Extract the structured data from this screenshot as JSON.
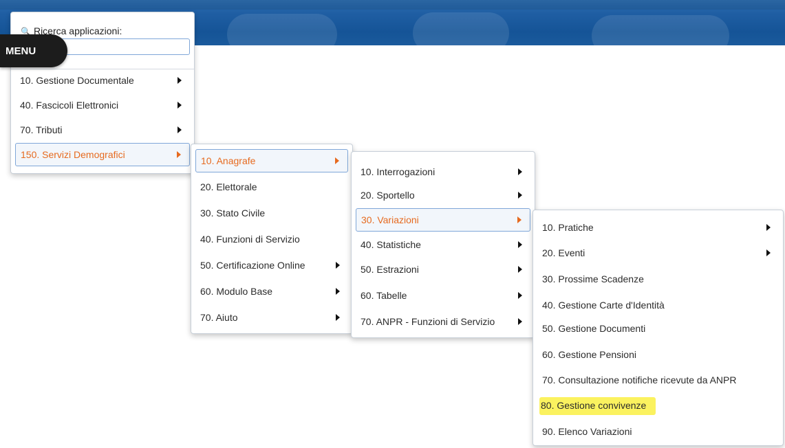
{
  "menu_button": {
    "label": "MENU"
  },
  "search": {
    "label": "Ricerca applicazioni:",
    "value": "",
    "placeholder": ""
  },
  "level1": [
    {
      "label": "10. Gestione Documentale",
      "submenu": true
    },
    {
      "label": "40. Fascicoli Elettronici",
      "submenu": true
    },
    {
      "label": "70. Tributi",
      "submenu": true
    },
    {
      "label": "150. Servizi Demografici",
      "submenu": true,
      "active": true
    }
  ],
  "level2": [
    {
      "label": "10. Anagrafe",
      "submenu": true,
      "active": true
    },
    {
      "label": "20. Elettorale"
    },
    {
      "label": "30. Stato Civile"
    },
    {
      "label": "40. Funzioni di Servizio"
    },
    {
      "label": "50. Certificazione Online",
      "submenu": true
    },
    {
      "label": "60. Modulo Base",
      "submenu": true
    },
    {
      "label": "70. Aiuto",
      "submenu": true
    }
  ],
  "level3": [
    {
      "label": "10. Interrogazioni",
      "submenu": true
    },
    {
      "label": "20. Sportello",
      "submenu": true
    },
    {
      "label": "30. Variazioni",
      "submenu": true,
      "active": true
    },
    {
      "label": "40. Statistiche",
      "submenu": true
    },
    {
      "label": "50. Estrazioni",
      "submenu": true
    },
    {
      "label": "60. Tabelle",
      "submenu": true
    },
    {
      "label": "70. ANPR - Funzioni di Servizio",
      "submenu": true
    }
  ],
  "level4": [
    {
      "label": "10. Pratiche",
      "submenu": true
    },
    {
      "label": "20. Eventi",
      "submenu": true
    },
    {
      "label": "30. Prossime Scadenze"
    },
    {
      "label": "40. Gestione Carte d'Identità"
    },
    {
      "label": "50. Gestione Documenti"
    },
    {
      "label": "60. Gestione Pensioni"
    },
    {
      "label": "70. Consultazione notifiche ricevute da ANPR"
    },
    {
      "label": "80. Gestione convivenze",
      "highlighted": true
    },
    {
      "label": "90. Elenco Variazioni"
    }
  ],
  "colors": {
    "active_text": "#e66a1f",
    "highlight": "#fbf25f",
    "header_blue": "#1a5a9c"
  }
}
